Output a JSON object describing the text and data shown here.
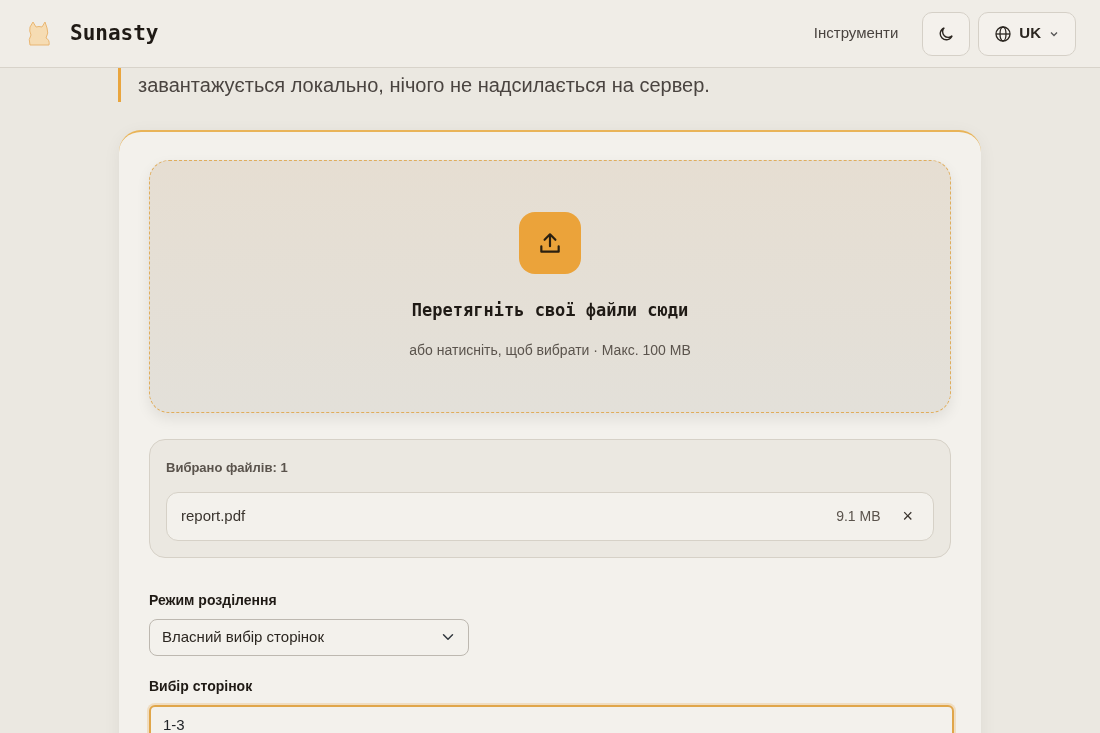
{
  "header": {
    "brand": "Sunasty",
    "nav_link": "Інструменти",
    "language": "UK"
  },
  "intro": {
    "text": "завантажується локально, нічого не надсилається на сервер."
  },
  "dropzone": {
    "title": "Перетягніть свої файли сюди",
    "hint": "або натисніть, щоб вибрати · Макс. 100 MB"
  },
  "selected_files": {
    "label": "Вибрано файлів: 1",
    "files": [
      {
        "name": "report.pdf",
        "size": "9.1 MB",
        "remove": "×"
      }
    ]
  },
  "split_mode": {
    "label": "Режим розділення",
    "value": "Власний вибір сторінок"
  },
  "page_selection": {
    "label": "Вибір сторінок",
    "value": "1-3",
    "focused": true
  }
}
